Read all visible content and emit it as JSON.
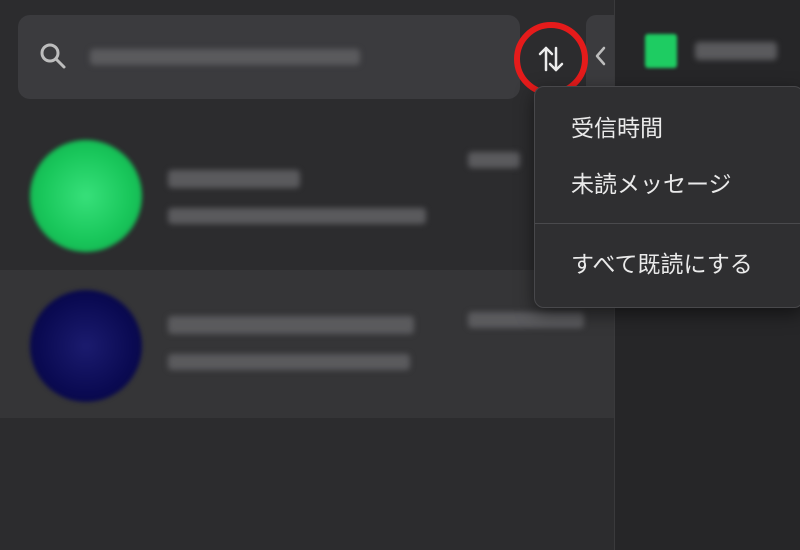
{
  "search": {
    "placeholder": "",
    "icon": "search-icon"
  },
  "toolbar": {
    "sort_icon": "sort-arrows-icon",
    "collapse_icon": "chevron-left-icon",
    "highlight_color": "#e51b1b"
  },
  "chats": [
    {
      "avatar_color": "#19c75b"
    },
    {
      "avatar_color": "#0a0a52"
    }
  ],
  "sort_menu": {
    "items": [
      {
        "label": "受信時間"
      },
      {
        "label": "未読メッセージ"
      },
      {
        "label": "すべて既読にする"
      }
    ]
  },
  "right_pane": {
    "badge_color": "#1ecc62"
  }
}
